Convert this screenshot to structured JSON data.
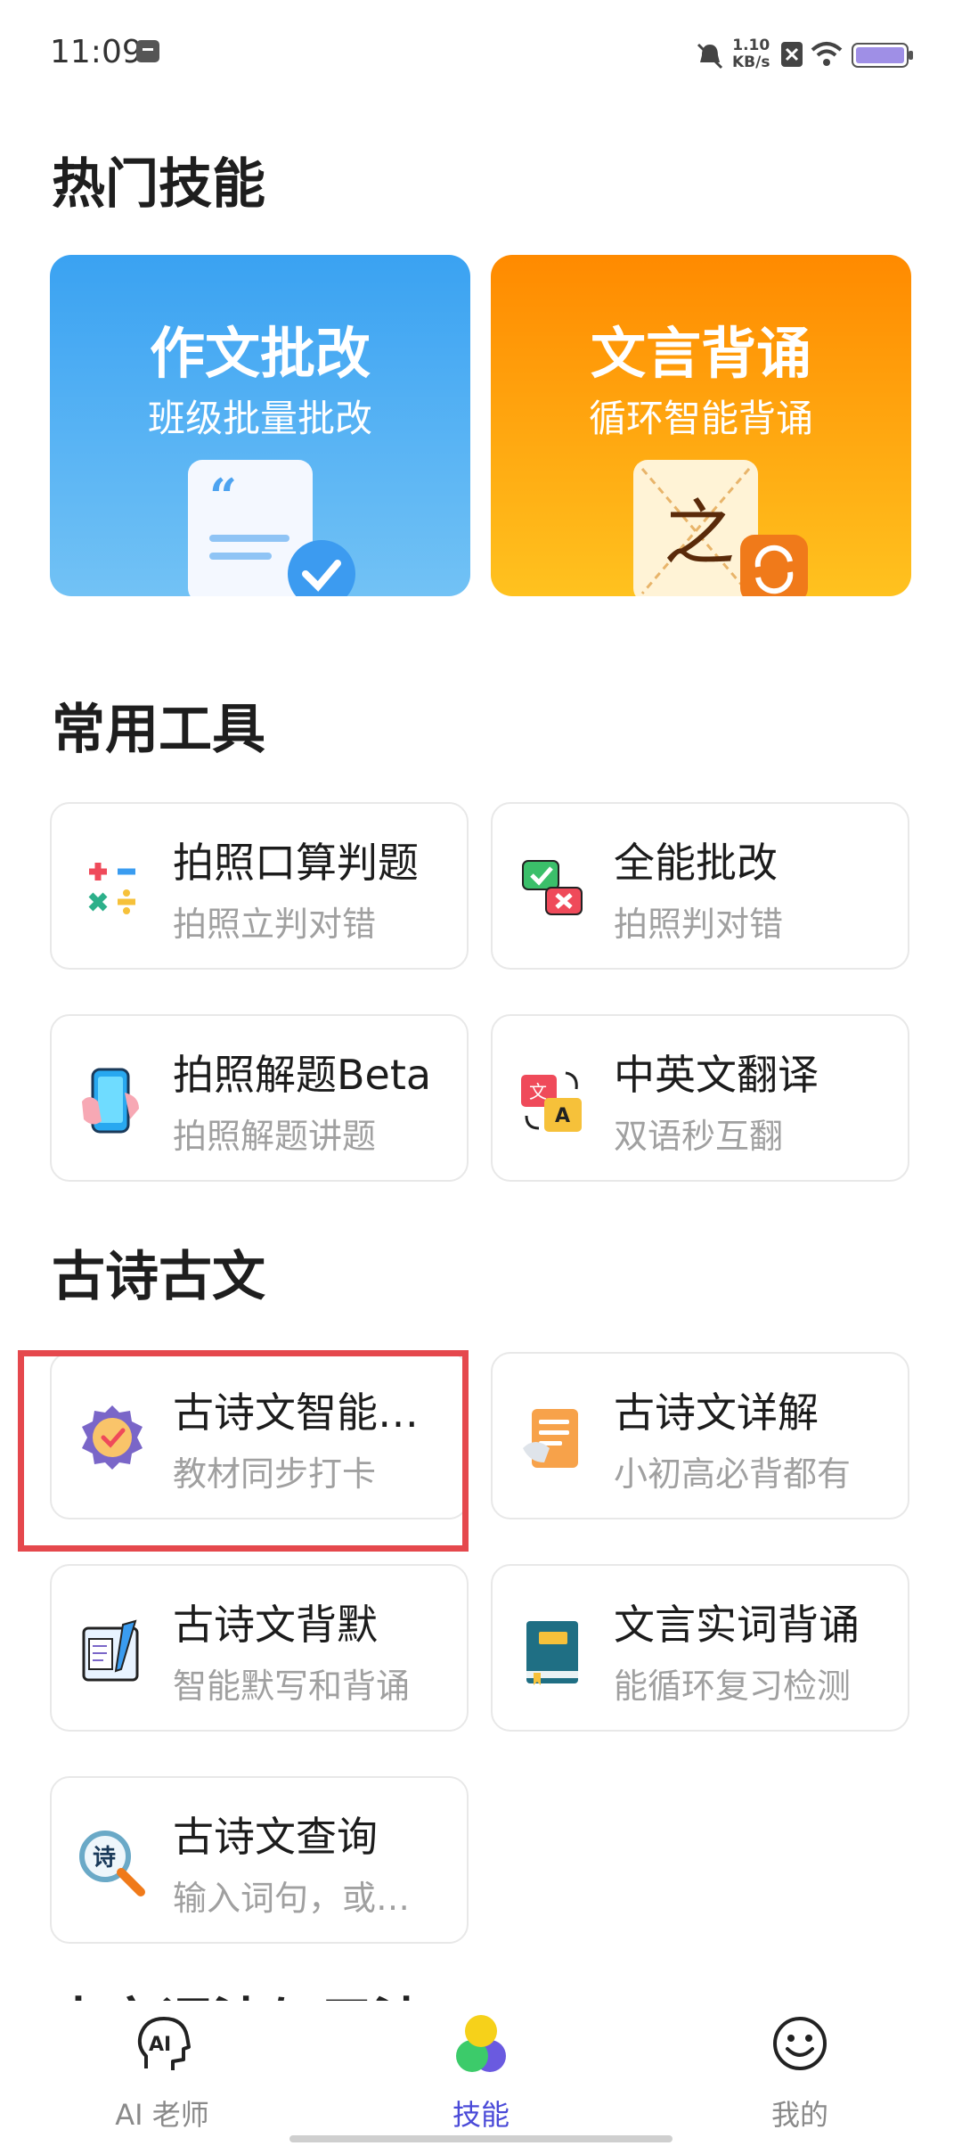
{
  "status_bar": {
    "time": "11:09",
    "net_speed": "1.10",
    "net_unit": "KB/s"
  },
  "sections": {
    "hot": "热门技能",
    "tools": "常用工具",
    "poetry": "古诗古文"
  },
  "hot_skills": [
    {
      "title": "作文批改",
      "subtitle": "班级批量批改",
      "color": "#4aaaf2"
    },
    {
      "title": "文言背诵",
      "subtitle": "循环智能背诵",
      "color": "#ff9a1a"
    }
  ],
  "tools": [
    {
      "title": "拍照口算判题",
      "subtitle": "拍照立判对错",
      "icon": "math-symbols-icon"
    },
    {
      "title": "全能批改",
      "subtitle": "拍照判对错",
      "icon": "check-cross-bubbles-icon"
    },
    {
      "title": "拍照解题Beta",
      "subtitle": "拍照解题讲题",
      "icon": "phone-hand-icon"
    },
    {
      "title": "中英文翻译",
      "subtitle": "双语秒互翻",
      "icon": "translate-icon"
    }
  ],
  "poetry": [
    {
      "title": "古诗文智能…",
      "subtitle": "教材同步打卡",
      "icon": "check-badge-icon"
    },
    {
      "title": "古诗文详解",
      "subtitle": "小初高必背都有",
      "icon": "scroll-icon"
    },
    {
      "title": "古诗文背默",
      "subtitle": "智能默写和背诵",
      "icon": "notebook-pen-icon"
    },
    {
      "title": "文言实词背诵",
      "subtitle": "能循环复习检测",
      "icon": "book-icon"
    },
    {
      "title": "古诗文查询",
      "subtitle": "输入词句，或…",
      "icon": "poem-search-icon"
    }
  ],
  "cutoff_heading": "古文词法与用法",
  "tabbar": {
    "items": [
      {
        "label": "AI 老师",
        "icon": "ai-head-icon"
      },
      {
        "label": "技能",
        "icon": "skills-balls-icon",
        "active": true
      },
      {
        "label": "我的",
        "icon": "smiley-icon"
      }
    ]
  }
}
